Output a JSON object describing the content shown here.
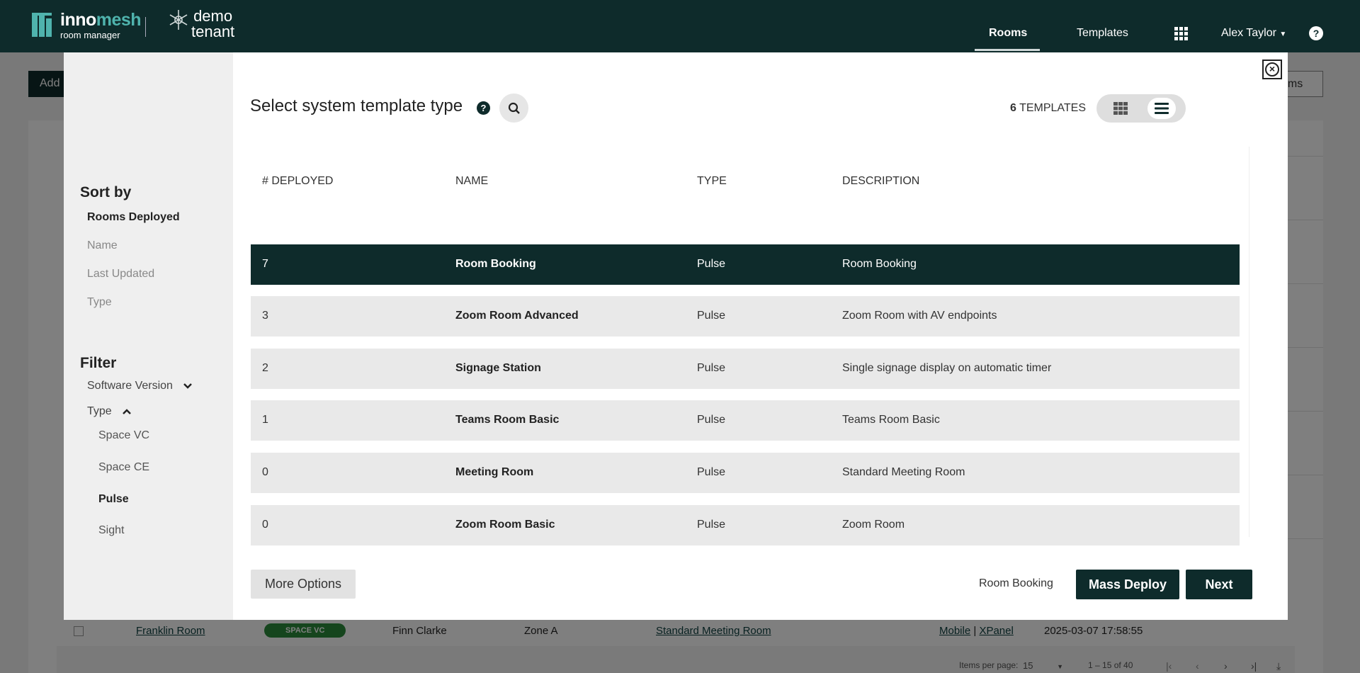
{
  "nav": {
    "brand_a": "inno",
    "brand_b": "mesh",
    "brand_sub": "room manager",
    "tenant_line1": "demo",
    "tenant_line2": "tenant",
    "rooms": "Rooms",
    "templates": "Templates",
    "user": "Alex Taylor",
    "help": "?"
  },
  "background": {
    "add_label": "Add",
    "rooms_btn": "oms",
    "row": {
      "name": "Franklin Room",
      "badge": "SPACE VC",
      "owner": "Finn Clarke",
      "zone": "Zone A",
      "template": "Standard Meeting Room",
      "link_mobile": "Mobile",
      "link_sep": "|",
      "link_xpanel": "XPanel",
      "timestamp": "2025-03-07 17:58:55"
    },
    "footer": {
      "items_per_page_label": "Items per page:",
      "items_per_page": "15",
      "range": "1 – 15 of 40"
    }
  },
  "modal": {
    "title": "Select system template type",
    "help": "?",
    "count": "6",
    "count_label": "TEMPLATES",
    "sidebar": {
      "sort_by": "Sort by",
      "sort_options": [
        "Rooms Deployed",
        "Name",
        "Last Updated",
        "Type"
      ],
      "filter": "Filter",
      "software_version": "Software Version",
      "type": "Type",
      "type_options": [
        "Space VC",
        "Space CE",
        "Pulse",
        "Sight"
      ]
    },
    "columns": {
      "deployed": "# DEPLOYED",
      "name": "NAME",
      "type": "TYPE",
      "description": "DESCRIPTION"
    },
    "rows": [
      {
        "deployed": "7",
        "name": "Room Booking",
        "type": "Pulse",
        "description": "Room Booking"
      },
      {
        "deployed": "3",
        "name": "Zoom Room Advanced",
        "type": "Pulse",
        "description": "Zoom Room with AV endpoints"
      },
      {
        "deployed": "2",
        "name": "Signage Station",
        "type": "Pulse",
        "description": "Single signage display on automatic timer"
      },
      {
        "deployed": "1",
        "name": "Teams Room Basic",
        "type": "Pulse",
        "description": "Teams Room Basic"
      },
      {
        "deployed": "0",
        "name": "Meeting Room",
        "type": "Pulse",
        "description": "Standard Meeting Room"
      },
      {
        "deployed": "0",
        "name": "Zoom Room Basic",
        "type": "Pulse",
        "description": "Zoom Room"
      }
    ],
    "footer": {
      "more_options": "More Options",
      "selected": "Room Booking",
      "mass_deploy": "Mass Deploy",
      "next": "Next"
    }
  },
  "colors": {
    "dark_teal": "#0e2b2b",
    "accent": "#4fb3ad",
    "badge_green": "#2a8b3a"
  }
}
